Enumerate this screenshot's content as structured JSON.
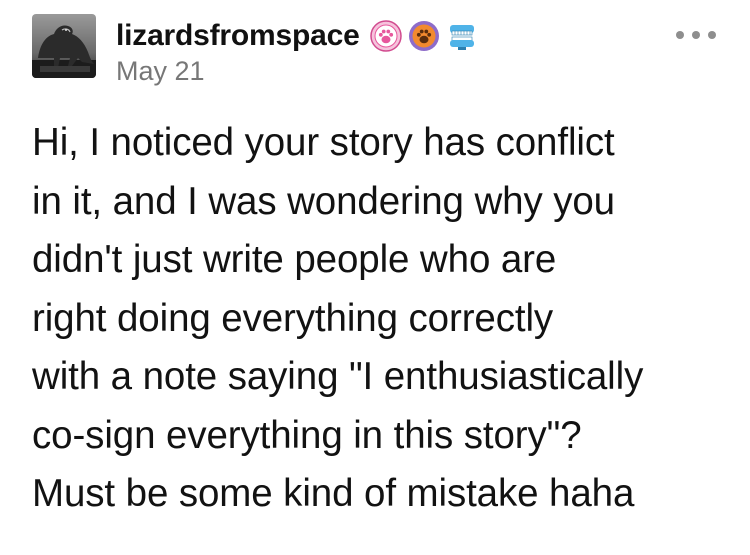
{
  "post": {
    "blog_name": "lizardsfromspace",
    "date": "May 21",
    "body_lines": [
      "Hi, I noticed your story has conflict",
      "in it, and I was wondering why you",
      "didn't just write people who are",
      "right doing everything correctly",
      "with a note saying \"I enthusiastically",
      "co-sign everything in this story\"?",
      "Must be some kind of mistake haha"
    ],
    "badges": [
      {
        "icon": "pink-paw-badge-icon",
        "color": "#e7589d"
      },
      {
        "icon": "orange-paw-badge-icon",
        "color": "#f28a2e"
      },
      {
        "icon": "chattering-teeth-badge-icon",
        "color": "#4fb3e8"
      }
    ],
    "more_icon": "ellipsis-icon"
  }
}
